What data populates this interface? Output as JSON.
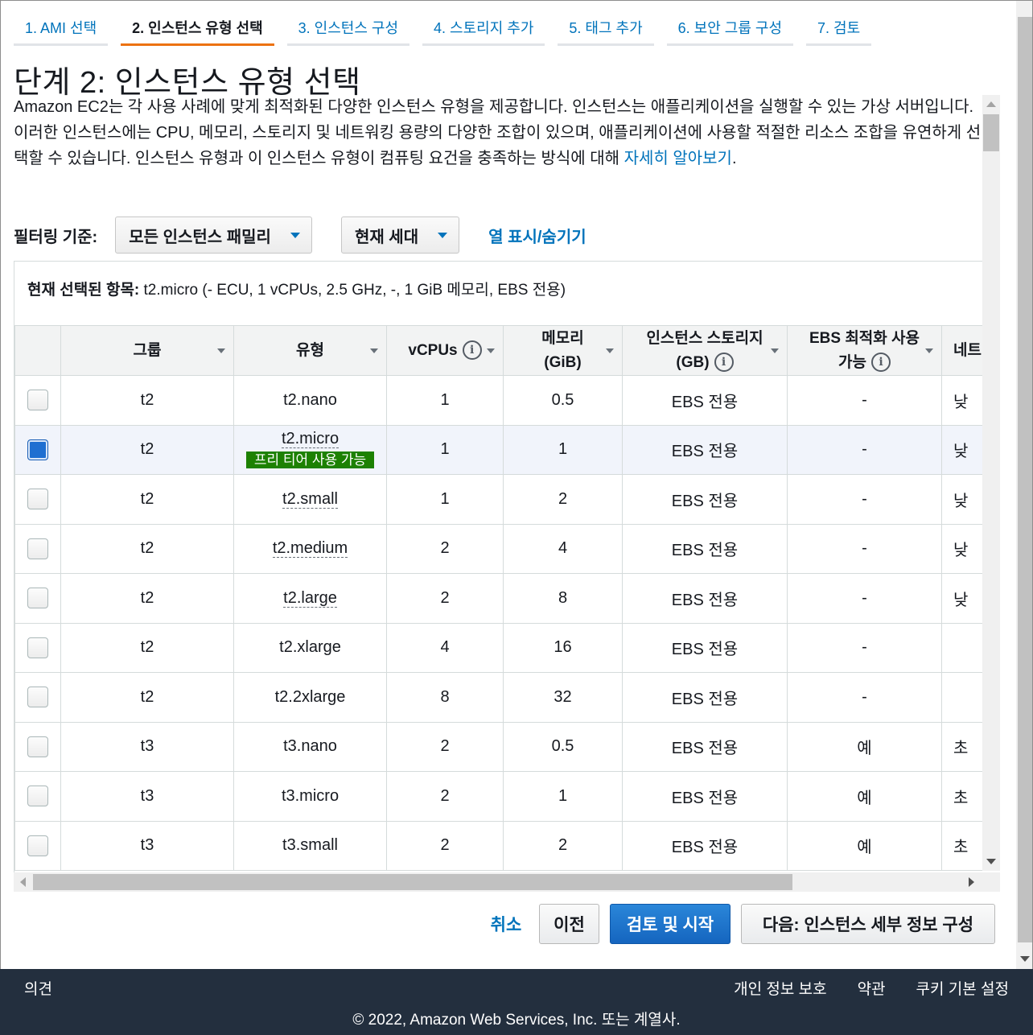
{
  "wizard": {
    "steps": [
      {
        "label": "1. AMI 선택"
      },
      {
        "label": "2. 인스턴스 유형 선택"
      },
      {
        "label": "3. 인스턴스 구성"
      },
      {
        "label": "4. 스토리지 추가"
      },
      {
        "label": "5. 태그 추가"
      },
      {
        "label": "6. 보안 그룹 구성"
      },
      {
        "label": "7. 검토"
      }
    ],
    "active_index": 1
  },
  "page": {
    "title": "단계 2: 인스턴스 유형 선택",
    "description": "Amazon EC2는 각 사용 사례에 맞게 최적화된 다양한 인스턴스 유형을 제공합니다. 인스턴스는 애플리케이션을 실행할 수 있는 가상 서버입니다. 이러한 인스턴스에는 CPU, 메모리, 스토리지 및 네트워킹 용량의 다양한 조합이 있으며, 애플리케이션에 사용할 적절한 리소스 조합을 유연하게 선택할 수 있습니다. 인스턴스 유형과 이 인스턴스 유형이 컴퓨팅 요건을 충족하는 방식에 대해 ",
    "learn_more": "자세히 알아보기",
    "learn_more_suffix": "."
  },
  "filters": {
    "label": "필터링 기준:",
    "family_select": "모든 인스턴스 패밀리",
    "generation_select": "현재 세대",
    "toggle_columns": "열 표시/숨기기"
  },
  "summary": {
    "label": "현재 선택된 항목:",
    "value": "t2.micro (- ECU, 1 vCPUs, 2.5 GHz, -, 1 GiB 메모리, EBS 전용)"
  },
  "table": {
    "headers": {
      "group": "그룹",
      "type": "유형",
      "vcpus": "vCPUs",
      "memory_line1": "메모리",
      "memory_line2": "(GiB)",
      "storage_line1": "인스턴스 스토리지",
      "storage_line2": "(GB)",
      "ebs_line1": "EBS 최적화 사용",
      "ebs_line2": "가능",
      "network": "네트",
      "info_glyph": "i"
    },
    "free_tier_badge": "프리 티어 사용 가능",
    "rows": [
      {
        "group": "t2",
        "type": "t2.nano",
        "vcpus": "1",
        "memory": "0.5",
        "storage": "EBS 전용",
        "ebs": "-",
        "network": "낮",
        "selected": false
      },
      {
        "group": "t2",
        "type": "t2.micro",
        "vcpus": "1",
        "memory": "1",
        "storage": "EBS 전용",
        "ebs": "-",
        "network": "낮",
        "selected": true
      },
      {
        "group": "t2",
        "type": "t2.small",
        "vcpus": "1",
        "memory": "2",
        "storage": "EBS 전용",
        "ebs": "-",
        "network": "낮",
        "selected": false
      },
      {
        "group": "t2",
        "type": "t2.medium",
        "vcpus": "2",
        "memory": "4",
        "storage": "EBS 전용",
        "ebs": "-",
        "network": "낮",
        "selected": false
      },
      {
        "group": "t2",
        "type": "t2.large",
        "vcpus": "2",
        "memory": "8",
        "storage": "EBS 전용",
        "ebs": "-",
        "network": "낮",
        "selected": false
      },
      {
        "group": "t2",
        "type": "t2.xlarge",
        "vcpus": "4",
        "memory": "16",
        "storage": "EBS 전용",
        "ebs": "-",
        "network": "",
        "selected": false
      },
      {
        "group": "t2",
        "type": "t2.2xlarge",
        "vcpus": "8",
        "memory": "32",
        "storage": "EBS 전용",
        "ebs": "-",
        "network": "",
        "selected": false
      },
      {
        "group": "t3",
        "type": "t3.nano",
        "vcpus": "2",
        "memory": "0.5",
        "storage": "EBS 전용",
        "ebs": "예",
        "network": "초",
        "selected": false
      },
      {
        "group": "t3",
        "type": "t3.micro",
        "vcpus": "2",
        "memory": "1",
        "storage": "EBS 전용",
        "ebs": "예",
        "network": "초",
        "selected": false
      },
      {
        "group": "t3",
        "type": "t3.small",
        "vcpus": "2",
        "memory": "2",
        "storage": "EBS 전용",
        "ebs": "예",
        "network": "초",
        "selected": false
      }
    ]
  },
  "actions": {
    "cancel": "취소",
    "previous": "이전",
    "review_launch": "검토 및 시작",
    "next": "다음: 인스턴스 세부 정보 구성"
  },
  "footer": {
    "feedback": "의견",
    "privacy": "개인 정보 보호",
    "terms": "약관",
    "cookies": "쿠키 기본 설정",
    "copyright": "© 2022, Amazon Web Services, Inc. 또는 계열사."
  },
  "colors": {
    "link": "#0073bb",
    "active_tab_underline": "#ec7211",
    "primary_button": "#1f6fd1",
    "free_tier_badge": "#1d8102",
    "footer_bg": "#232f3e"
  }
}
